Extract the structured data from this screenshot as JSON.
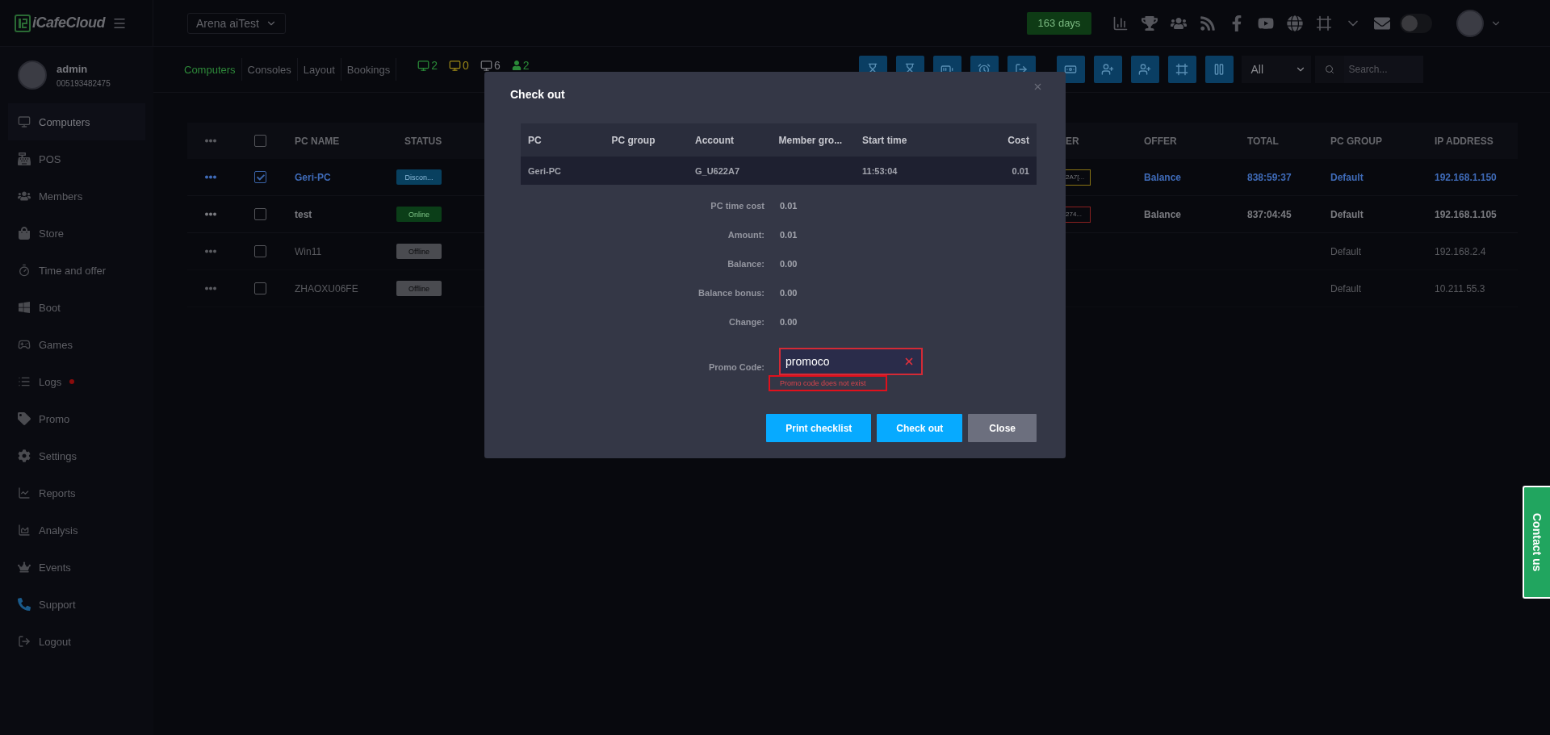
{
  "header": {
    "logo": "iCafeCloud",
    "store_selector": "Arena aiTest",
    "license_badge": "163 days",
    "theme_switch": {
      "on": false
    }
  },
  "user": {
    "name": "admin",
    "id": "005193482475"
  },
  "sidebar": {
    "items": [
      {
        "label": "Computers",
        "selected": true,
        "alert": false
      },
      {
        "label": "POS",
        "selected": false,
        "alert": false
      },
      {
        "label": "Members",
        "selected": false,
        "alert": false
      },
      {
        "label": "Store",
        "selected": false,
        "alert": false
      },
      {
        "label": "Time and offer",
        "selected": false,
        "alert": false
      },
      {
        "label": "Boot",
        "selected": false,
        "alert": false
      },
      {
        "label": "Games",
        "selected": false,
        "alert": false
      },
      {
        "label": "Logs",
        "selected": false,
        "alert": true
      },
      {
        "label": "Promo",
        "selected": false,
        "alert": false
      },
      {
        "label": "Settings",
        "selected": false,
        "alert": false
      },
      {
        "label": "Reports",
        "selected": false,
        "alert": false
      },
      {
        "label": "Analysis",
        "selected": false,
        "alert": false
      },
      {
        "label": "Events",
        "selected": false,
        "alert": false
      },
      {
        "label": "Support",
        "selected": false,
        "alert": false
      },
      {
        "label": "Logout",
        "selected": false,
        "alert": false
      }
    ]
  },
  "tabs": [
    {
      "label": "Computers",
      "selected": true
    },
    {
      "label": "Consoles",
      "selected": false
    },
    {
      "label": "Layout",
      "selected": false
    },
    {
      "label": "Bookings",
      "selected": false
    }
  ],
  "counters": [
    {
      "kind": "monitor",
      "value": "2",
      "color": "#2a8a38"
    },
    {
      "kind": "monitor",
      "value": "0",
      "color": "#9a8616"
    },
    {
      "kind": "monitor",
      "value": "6",
      "color": "#77787e"
    },
    {
      "kind": "user",
      "value": "2",
      "color": "#2a8a38"
    }
  ],
  "filter": {
    "value": "All"
  },
  "search": {
    "placeholder": "Search..."
  },
  "table": {
    "all_checked": false,
    "columns": [
      "PC NAME",
      "STATUS",
      "ER",
      "OFFER",
      "TOTAL",
      "PC GROUP",
      "IP ADDRESS"
    ],
    "rows": [
      {
        "selected": true,
        "checked": true,
        "dim": false,
        "name": "Geri-PC",
        "status": {
          "text": "Discon...",
          "kind": "disconnected"
        },
        "tag": {
          "text": "2A7[...",
          "color": "#8a7414"
        },
        "offer": "Balance",
        "total": "838:59:37",
        "group": "Default",
        "ip": "192.168.1.150"
      },
      {
        "selected": false,
        "checked": false,
        "dim": false,
        "name": "test",
        "status": {
          "text": "Online",
          "kind": "online"
        },
        "tag": {
          "text": "274...",
          "color": "#8a2020"
        },
        "offer": "Balance",
        "total": "837:04:45",
        "group": "Default",
        "ip": "192.168.1.105"
      },
      {
        "selected": false,
        "checked": false,
        "dim": true,
        "name": "Win11",
        "status": {
          "text": "Offline",
          "kind": "offline"
        },
        "group": "Default",
        "ip": "192.168.2.4"
      },
      {
        "selected": false,
        "checked": false,
        "dim": true,
        "name": "ZHAOXU06FE",
        "status": {
          "text": "Offline",
          "kind": "offline"
        },
        "group": "Default",
        "ip": "10.211.55.3"
      }
    ]
  },
  "dialog": {
    "title": "Check out",
    "table": {
      "columns": [
        "PC",
        "PC group",
        "Account",
        "Member gro...",
        "Start time",
        "Cost"
      ],
      "row": {
        "pc": "Geri-PC",
        "account": "G_U622A7",
        "start_time": "11:53:04",
        "cost": "0.01"
      }
    },
    "summary": [
      {
        "label": "PC time cost",
        "value": "0.01"
      },
      {
        "label": "Amount:",
        "value": "0.01"
      },
      {
        "label": "Balance:",
        "value": "0.00"
      },
      {
        "label": "Balance bonus:",
        "value": "0.00"
      },
      {
        "label": "Change:",
        "value": "0.00"
      }
    ],
    "promo": {
      "label": "Promo Code:",
      "value": "promoco",
      "error": "Promo code does not exist"
    },
    "buttons": [
      {
        "label": "Print checklist",
        "kind": "primary"
      },
      {
        "label": "Check out",
        "kind": "primary"
      },
      {
        "label": "Close",
        "kind": "secondary"
      }
    ]
  },
  "contact": {
    "label": "Contact us"
  }
}
